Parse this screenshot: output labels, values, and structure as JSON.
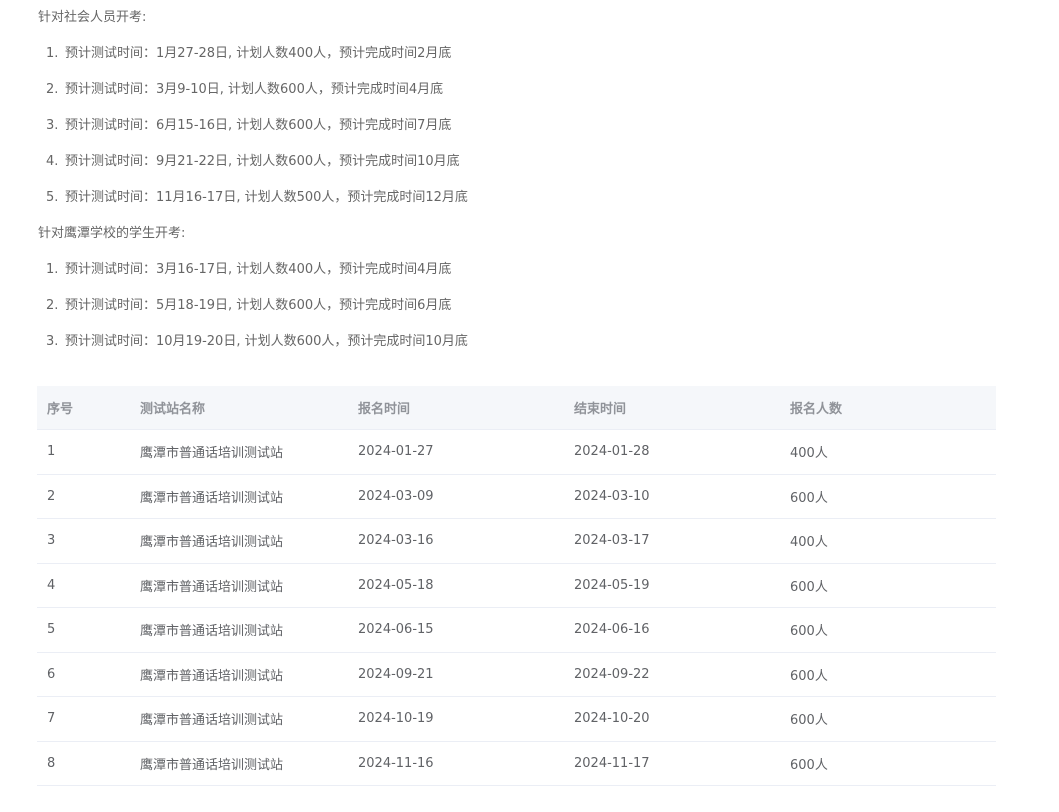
{
  "social": {
    "heading": "针对社会人员开考:",
    "items": [
      {
        "num": "1.",
        "text": "预计测试时间：1月27-28日, 计划人数400人，预计完成时间2月底"
      },
      {
        "num": "2.",
        "text": "预计测试时间：3月9-10日, 计划人数600人，预计完成时间4月底"
      },
      {
        "num": "3.",
        "text": "预计测试时间：6月15-16日, 计划人数600人，预计完成时间7月底"
      },
      {
        "num": "4.",
        "text": "预计测试时间：9月21-22日, 计划人数600人，预计完成时间10月底"
      },
      {
        "num": "5.",
        "text": "预计测试时间：11月16-17日, 计划人数500人，预计完成时间12月底"
      }
    ]
  },
  "students": {
    "heading": "针对鹰潭学校的学生开考:",
    "items": [
      {
        "num": "1.",
        "text": "预计测试时间：3月16-17日, 计划人数400人，预计完成时间4月底"
      },
      {
        "num": "2.",
        "text": "预计测试时间：5月18-19日, 计划人数600人，预计完成时间6月底"
      },
      {
        "num": "3.",
        "text": "预计测试时间：10月19-20日, 计划人数600人，预计完成时间10月底"
      }
    ]
  },
  "table": {
    "headers": [
      "序号",
      "测试站名称",
      "报名时间",
      "结束时间",
      "报名人数"
    ],
    "rows": [
      [
        "1",
        "鹰潭市普通话培训测试站",
        "2024-01-27",
        "2024-01-28",
        "400人"
      ],
      [
        "2",
        "鹰潭市普通话培训测试站",
        "2024-03-09",
        "2024-03-10",
        "600人"
      ],
      [
        "3",
        "鹰潭市普通话培训测试站",
        "2024-03-16",
        "2024-03-17",
        "400人"
      ],
      [
        "4",
        "鹰潭市普通话培训测试站",
        "2024-05-18",
        "2024-05-19",
        "600人"
      ],
      [
        "5",
        "鹰潭市普通话培训测试站",
        "2024-06-15",
        "2024-06-16",
        "600人"
      ],
      [
        "6",
        "鹰潭市普通话培训测试站",
        "2024-09-21",
        "2024-09-22",
        "600人"
      ],
      [
        "7",
        "鹰潭市普通话培训测试站",
        "2024-10-19",
        "2024-10-20",
        "600人"
      ],
      [
        "8",
        "鹰潭市普通话培训测试站",
        "2024-11-16",
        "2024-11-17",
        "600人"
      ]
    ]
  }
}
